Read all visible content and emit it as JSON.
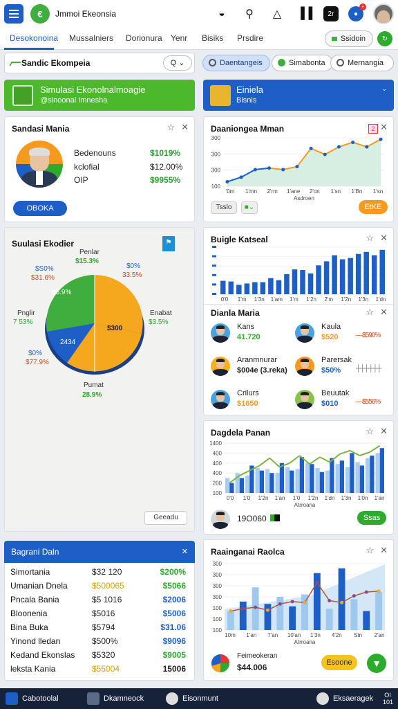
{
  "app": {
    "title": "Jmmoi Ekeonsia"
  },
  "topbar": {
    "icons": [
      "fire-icon",
      "search-icon",
      "bell-icon",
      "barcode-icon",
      "alert-square-icon",
      "notification-icon",
      "user-avatar"
    ],
    "badge_label": "2r"
  },
  "tabs": [
    {
      "label": "Desokonoina",
      "active": true
    },
    {
      "label": "Mussalniers"
    },
    {
      "label": "Dorionura"
    },
    {
      "label": "Yenr"
    },
    {
      "label": "Bisiks"
    },
    {
      "label": "Prsdire"
    }
  ],
  "tab_button": "Ssidoin",
  "filterbar": {
    "label": "Sandic Ekompeia",
    "search": "Q",
    "chips": [
      "Daentangeis",
      "Simabonta",
      "Mernangia"
    ]
  },
  "banners": {
    "left": {
      "title": "Simulasi Ekonolnalmoagie",
      "subtitle": "@sinoonal Imnesha"
    },
    "right": {
      "title": "Einiela",
      "subtitle": "Bisnis"
    }
  },
  "profile_card": {
    "title": "Sandasi Mania",
    "rows": [
      {
        "label": "Bedenouns",
        "value": "$1019%"
      },
      {
        "label": "kclofial",
        "value": "$12.00%"
      },
      {
        "label": "OIP",
        "value": "$9955%"
      }
    ],
    "button": "OBOKA"
  },
  "pie_card": {
    "title": "Suulasi Ekodier",
    "labels": {
      "top": {
        "name": "Penlar",
        "value": "$15.3%"
      },
      "tl1": {
        "name": "$S0%",
        "value": "$31.6%"
      },
      "tr1": {
        "name": "$0%",
        "value": "33.5%"
      },
      "left": {
        "name": "Pnglir",
        "value": "7 53%"
      },
      "right": {
        "name": "Enabat",
        "value": "$3.5%"
      },
      "bl": {
        "name": "$0%",
        "value": "$77.9%"
      },
      "bottom": {
        "name": "Pumat",
        "value": "28.9%"
      },
      "slice_green": "95.9%",
      "slice_orange": "$300",
      "slice_blue": "2434"
    },
    "button": "Geeadu"
  },
  "chart1": {
    "title": "Daaniongea Mman",
    "badge": "2",
    "filter_btn": "Tsslo",
    "action_btn": "EtKE"
  },
  "chart2": {
    "title": "Buigle Katseal"
  },
  "people_card": {
    "title": "Dianla Maria",
    "people": [
      {
        "name": "Kans",
        "value": "41.720",
        "color": "green"
      },
      {
        "name": "Kaula",
        "value": "$520",
        "color": "orange",
        "note": "$590%"
      },
      {
        "name": "Aranmnurar",
        "value": "$004e (3.reka)",
        "color": "dark"
      },
      {
        "name": "Parersak",
        "value": "$50%",
        "color": "blue"
      },
      {
        "name": "Crilurs",
        "value": "$1650",
        "color": "orange"
      },
      {
        "name": "Beuutak",
        "value": "$010",
        "color": "blue",
        "note": "$556%"
      }
    ]
  },
  "chart3": {
    "title": "Dagdela Panan",
    "footer_value": "19O060",
    "button": "Ssas"
  },
  "chart4": {
    "title": "Raainganai Raolca",
    "footer_label": "Feimeokeran",
    "footer_value": "$44.006",
    "button": "Esoone"
  },
  "table": {
    "title": "Bagrani Daln",
    "rows": [
      {
        "name": "Simortania",
        "v1": "$32 120",
        "v2": "$200%",
        "color": "green"
      },
      {
        "name": "Umanian Dnela",
        "v1": "$500065",
        "v2": "$5066",
        "color": "green"
      },
      {
        "name": "Pncala Bania",
        "v1": "$5 1016",
        "v2": "$2006",
        "color": "blue"
      },
      {
        "name": "Bloonenia",
        "v1": "$5016",
        "v2": "$5006",
        "color": "blue"
      },
      {
        "name": "Bina Buka",
        "v1": "$5794",
        "v2": "$31.06",
        "color": "blue"
      },
      {
        "name": "Yinond lledan",
        "v1": "$500%",
        "v2": "$9096",
        "color": "blue"
      },
      {
        "name": "Kedand Ekonslas",
        "v1": "$5320",
        "v2": "$9005",
        "color": "green"
      },
      {
        "name": "leksta Kania",
        "v1": "$55004",
        "v2": "15006",
        "color": "dark"
      }
    ]
  },
  "bottombar": {
    "items": [
      "Cabotoolal",
      "Dkamneock",
      "Eisonmunt",
      "Eksaeragek"
    ],
    "end_label": "OI 101"
  },
  "chart_data": [
    {
      "type": "line",
      "title": "Daaniongea Mman",
      "y_ticks": [
        "300",
        "300",
        "300",
        "100"
      ],
      "x_ticks": [
        "'0m",
        "1'mn",
        "2'rm",
        "1'ane",
        "2'on",
        "1'sn",
        "1'Bn",
        "1'sn"
      ],
      "x_label": "Asdroen",
      "values": [
        30,
        60,
        110,
        120,
        110,
        130,
        250,
        210,
        260,
        290,
        260,
        310
      ]
    },
    {
      "type": "bar",
      "title": "Buigle Katseal",
      "x_ticks": [
        "0'0",
        "1'm",
        "1'3n",
        "1'am",
        "1'm",
        "1'2n",
        "2'm",
        "1'2n",
        "1'3n",
        "1'dn"
      ],
      "values": [
        40,
        38,
        28,
        32,
        36,
        36,
        48,
        42,
        60,
        74,
        72,
        62,
        86,
        98,
        116,
        104,
        108,
        120,
        126,
        116,
        132
      ]
    },
    {
      "type": "bar",
      "title": "Dagdela Panan",
      "y_ticks": [
        "1400",
        "400",
        "400",
        "400",
        "200",
        "100"
      ],
      "x_ticks": [
        "0'0",
        "1'0",
        "1'2n",
        "1'an",
        "1'0",
        "1'2n",
        "1'dn",
        "1'3n",
        "1'0n",
        "1'an"
      ],
      "x_label": "Atrroana",
      "series": [
        {
          "name": "dark",
          "values": [
            20,
            30,
            55,
            45,
            40,
            60,
            45,
            72,
            58,
            42,
            70,
            65,
            80,
            55,
            75,
            90
          ]
        },
        {
          "name": "light",
          "values": [
            30,
            40,
            35,
            50,
            48,
            40,
            52,
            48,
            60,
            50,
            45,
            58,
            52,
            62,
            70,
            80
          ]
        }
      ],
      "line_values": [
        20,
        35,
        45,
        55,
        70,
        52,
        60,
        75,
        58,
        72,
        62,
        78,
        85,
        75,
        82,
        95
      ]
    },
    {
      "type": "bar",
      "title": "Raainganai Raolca",
      "y_ticks": [
        "300",
        "300",
        "300",
        "300",
        "100",
        "100",
        "100"
      ],
      "x_ticks": [
        "10m",
        "1'an",
        "7'an",
        "10'an",
        "1'3n",
        "4'2n",
        "Stn",
        "2'an"
      ],
      "x_label": "Atrroana",
      "bars": [
        40,
        60,
        90,
        55,
        70,
        50,
        75,
        120,
        45,
        130,
        65,
        40,
        80
      ],
      "line_values": [
        40,
        45,
        48,
        42,
        55,
        60,
        58,
        100,
        62,
        58,
        72,
        80,
        82
      ]
    }
  ]
}
